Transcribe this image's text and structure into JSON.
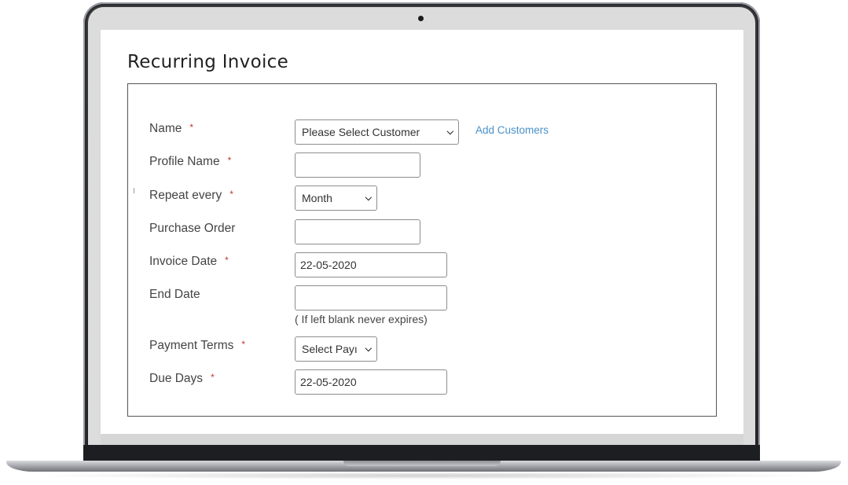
{
  "page": {
    "title": "Recurring Invoice"
  },
  "form": {
    "name": {
      "label": "Name",
      "required_mark": "*",
      "selected": "Please Select Customer",
      "add_link": "Add Customers"
    },
    "profile_name": {
      "label": "Profile Name",
      "required_mark": "*",
      "value": ""
    },
    "repeat_every": {
      "label": "Repeat every",
      "required_mark": "*",
      "selected": "Month"
    },
    "purchase_order": {
      "label": "Purchase Order",
      "value": ""
    },
    "invoice_date": {
      "label": "Invoice Date",
      "required_mark": "*",
      "value": "22-05-2020"
    },
    "end_date": {
      "label": "End Date",
      "value": "",
      "hint": "( If left blank never expires)"
    },
    "payment_terms": {
      "label": "Payment Terms",
      "required_mark": "*",
      "selected": "Select Payı"
    },
    "due_days": {
      "label": "Due Days",
      "required_mark": "*",
      "value": "22-05-2020"
    }
  },
  "icons": {
    "select_arrow": "chevron-down-icon",
    "camera": "camera-icon"
  },
  "colors": {
    "required": "#c0392b",
    "link": "#4a90c8",
    "border": "#8d8d8d",
    "bezel": "#202124"
  }
}
